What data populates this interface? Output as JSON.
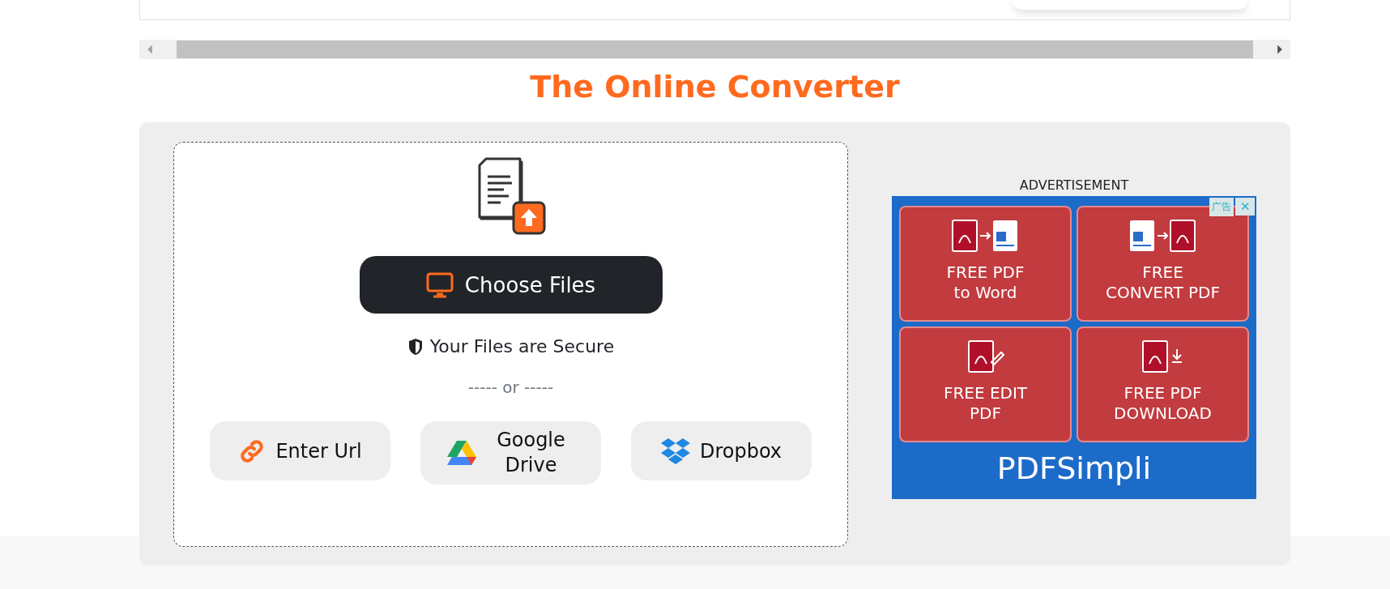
{
  "title": "The Online Converter",
  "upload": {
    "choose_button": "Choose Files",
    "secure_note": "Your Files are Secure",
    "separator": "----- or -----",
    "sources": [
      {
        "kind": "url",
        "label": "Enter Url"
      },
      {
        "kind": "gdrive",
        "label": "Google Drive"
      },
      {
        "kind": "dropbox",
        "label": "Dropbox"
      }
    ]
  },
  "advertisement": {
    "heading": "ADVERTISEMENT",
    "ad_badge": "广告",
    "close": "✕",
    "brand": "PDFSimpli",
    "tiles": [
      {
        "kind": "pdf-to-word",
        "lines": [
          "FREE PDF",
          "to Word"
        ]
      },
      {
        "kind": "word-to-pdf",
        "lines": [
          "FREE",
          "CONVERT PDF"
        ]
      },
      {
        "kind": "edit",
        "lines": [
          "FREE EDIT",
          "PDF"
        ]
      },
      {
        "kind": "download",
        "lines": [
          "FREE PDF",
          "DOWNLOAD"
        ]
      }
    ]
  }
}
